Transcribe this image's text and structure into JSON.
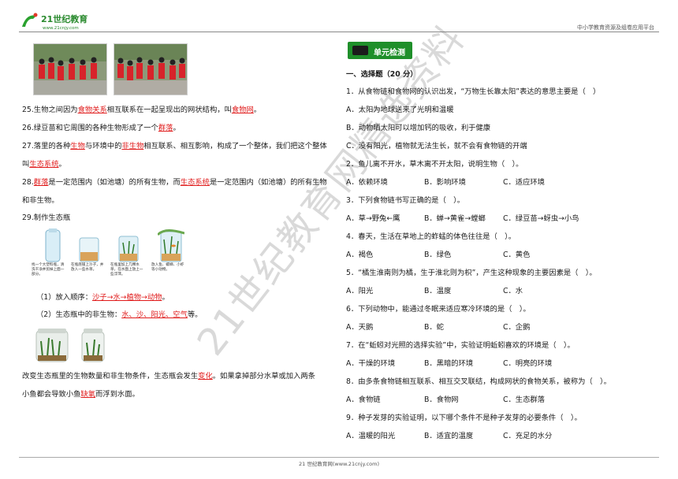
{
  "header": {
    "logo_text": "21世纪教育",
    "logo_sub": "www.21cnjy.com",
    "right_text": "中小学教育资源及组卷应用平台"
  },
  "footer": {
    "text": "21 世纪教育网(www.21cnjy.com)"
  },
  "watermark": {
    "text": "21世纪教育网精选资料"
  },
  "left": {
    "q25": {
      "pre": "25.生物之间因为",
      "a1": "食物关系",
      "mid": "相互联系在一起呈现出的网状结构，叫",
      "a2": "食物网",
      "post": "。"
    },
    "q26": {
      "pre": "26.绿豆苗和它周围的各种生物形成了一个",
      "a1": "群落",
      "post": "。"
    },
    "q27": {
      "pre": "27.落里的各种",
      "a1": "生物",
      "mid1": "与环境中的",
      "a2": "非生物",
      "mid2": "相互联系、相互影响，构成了一个整体，我们把这个整体",
      "line2_pre": "叫",
      "a3": "生态系统",
      "post": "。"
    },
    "q28": {
      "a1": "群落",
      "mid1": "是一定范围内（如池塘）的所有生物，而",
      "a2": "生态系统",
      "mid2": "是一定范围内（如池塘）的所有生物",
      "line2": "和非生物。"
    },
    "q29": {
      "title": "29.制作生态瓶",
      "steps": [
        "找一个大塑料瓶，清洗干净并剪掉上面一部分。",
        "在瓶底铺上沙子，并放入一些水草。",
        "在瓶里加上几棵水草，在水面上放上一些浮萍。",
        "放入鱼、螺蛳、小虾等小动物。"
      ],
      "s1_pre": "（1）放入顺序：",
      "s1_ans": "沙子→水→植物→动物",
      "s1_post": "。",
      "s2_pre": "（2）生态瓶中的非生物：",
      "s2_ans": "水、沙、阳光、空气",
      "s2_post": "等。",
      "p1_pre": "改变生态瓶里的生物数量和非生物条件，生态瓶会发生",
      "p1_ans": "变化",
      "p1_post": "。如果拿掉部分水草或加入两条",
      "p2_pre": "小鱼都会导致小鱼",
      "p2_ans": "缺氧",
      "p2_post": "而浮到水面。"
    }
  },
  "right": {
    "badge": "单元检测",
    "section": "一、选择题（20 分）",
    "questions": [
      {
        "q": "1．从食物链和食物网的认识出发，“万物生长靠太阳”表达的意思主要是（　）",
        "opts": [
          "A．太阳为地球送来了光明和温暖",
          "B．动物晒太阳可以增加钙的吸收，利于健康",
          "C．没有阳光，植物就无法生长，就不会有食物链的开端"
        ]
      },
      {
        "q": "2．鱼儿离不开水，草木离不开太阳，说明生物（　）。",
        "opts": [
          "A．依赖环境",
          "B．影响环境",
          "C．适应环境"
        ]
      },
      {
        "q": "3．下列食物链书写正确的是（　）。",
        "opts": [
          "A．草→野兔←鹰",
          "B．蝉→黄雀→螳螂",
          "C．绿豆苗→蚜虫→小鸟"
        ]
      },
      {
        "q": "4．春天，生活在草地上的蚱蜢的体色往往是（　）。",
        "opts": [
          "A．褐色",
          "B．绿色",
          "C．黄色"
        ]
      },
      {
        "q": "5．“橘生淮南则为橘，生于淮北则为枳”，产生这种现象的主要因素是（　）。",
        "opts": [
          "A．阳光",
          "B．温度",
          "C．水"
        ]
      },
      {
        "q": "6．下列动物中，能通过冬眠来适应寒冷环境的是（　）。",
        "opts": [
          "A．天鹅",
          "B．蛇",
          "C．企鹅"
        ]
      },
      {
        "q": "7．在“蚯蚓对光照的选择实验”中，实验证明蚯蚓喜欢的环境是（　）。",
        "opts": [
          "A．干燥的环境",
          "B．黑暗的环境",
          "C．明亮的环境"
        ]
      },
      {
        "q": "8．由多条食物链相互联系、相互交叉联结，构成网状的食物关系，被称为（　）。",
        "opts": [
          "A．食物链",
          "B．食物网",
          "C．生态群落"
        ]
      },
      {
        "q": "9．种子发芽的实验证明，以下哪个条件不是种子发芽的必要条件（　）。",
        "opts": [
          "A．温暖的阳光",
          "B．适宜的温度",
          "C．充足的水分"
        ]
      }
    ]
  }
}
